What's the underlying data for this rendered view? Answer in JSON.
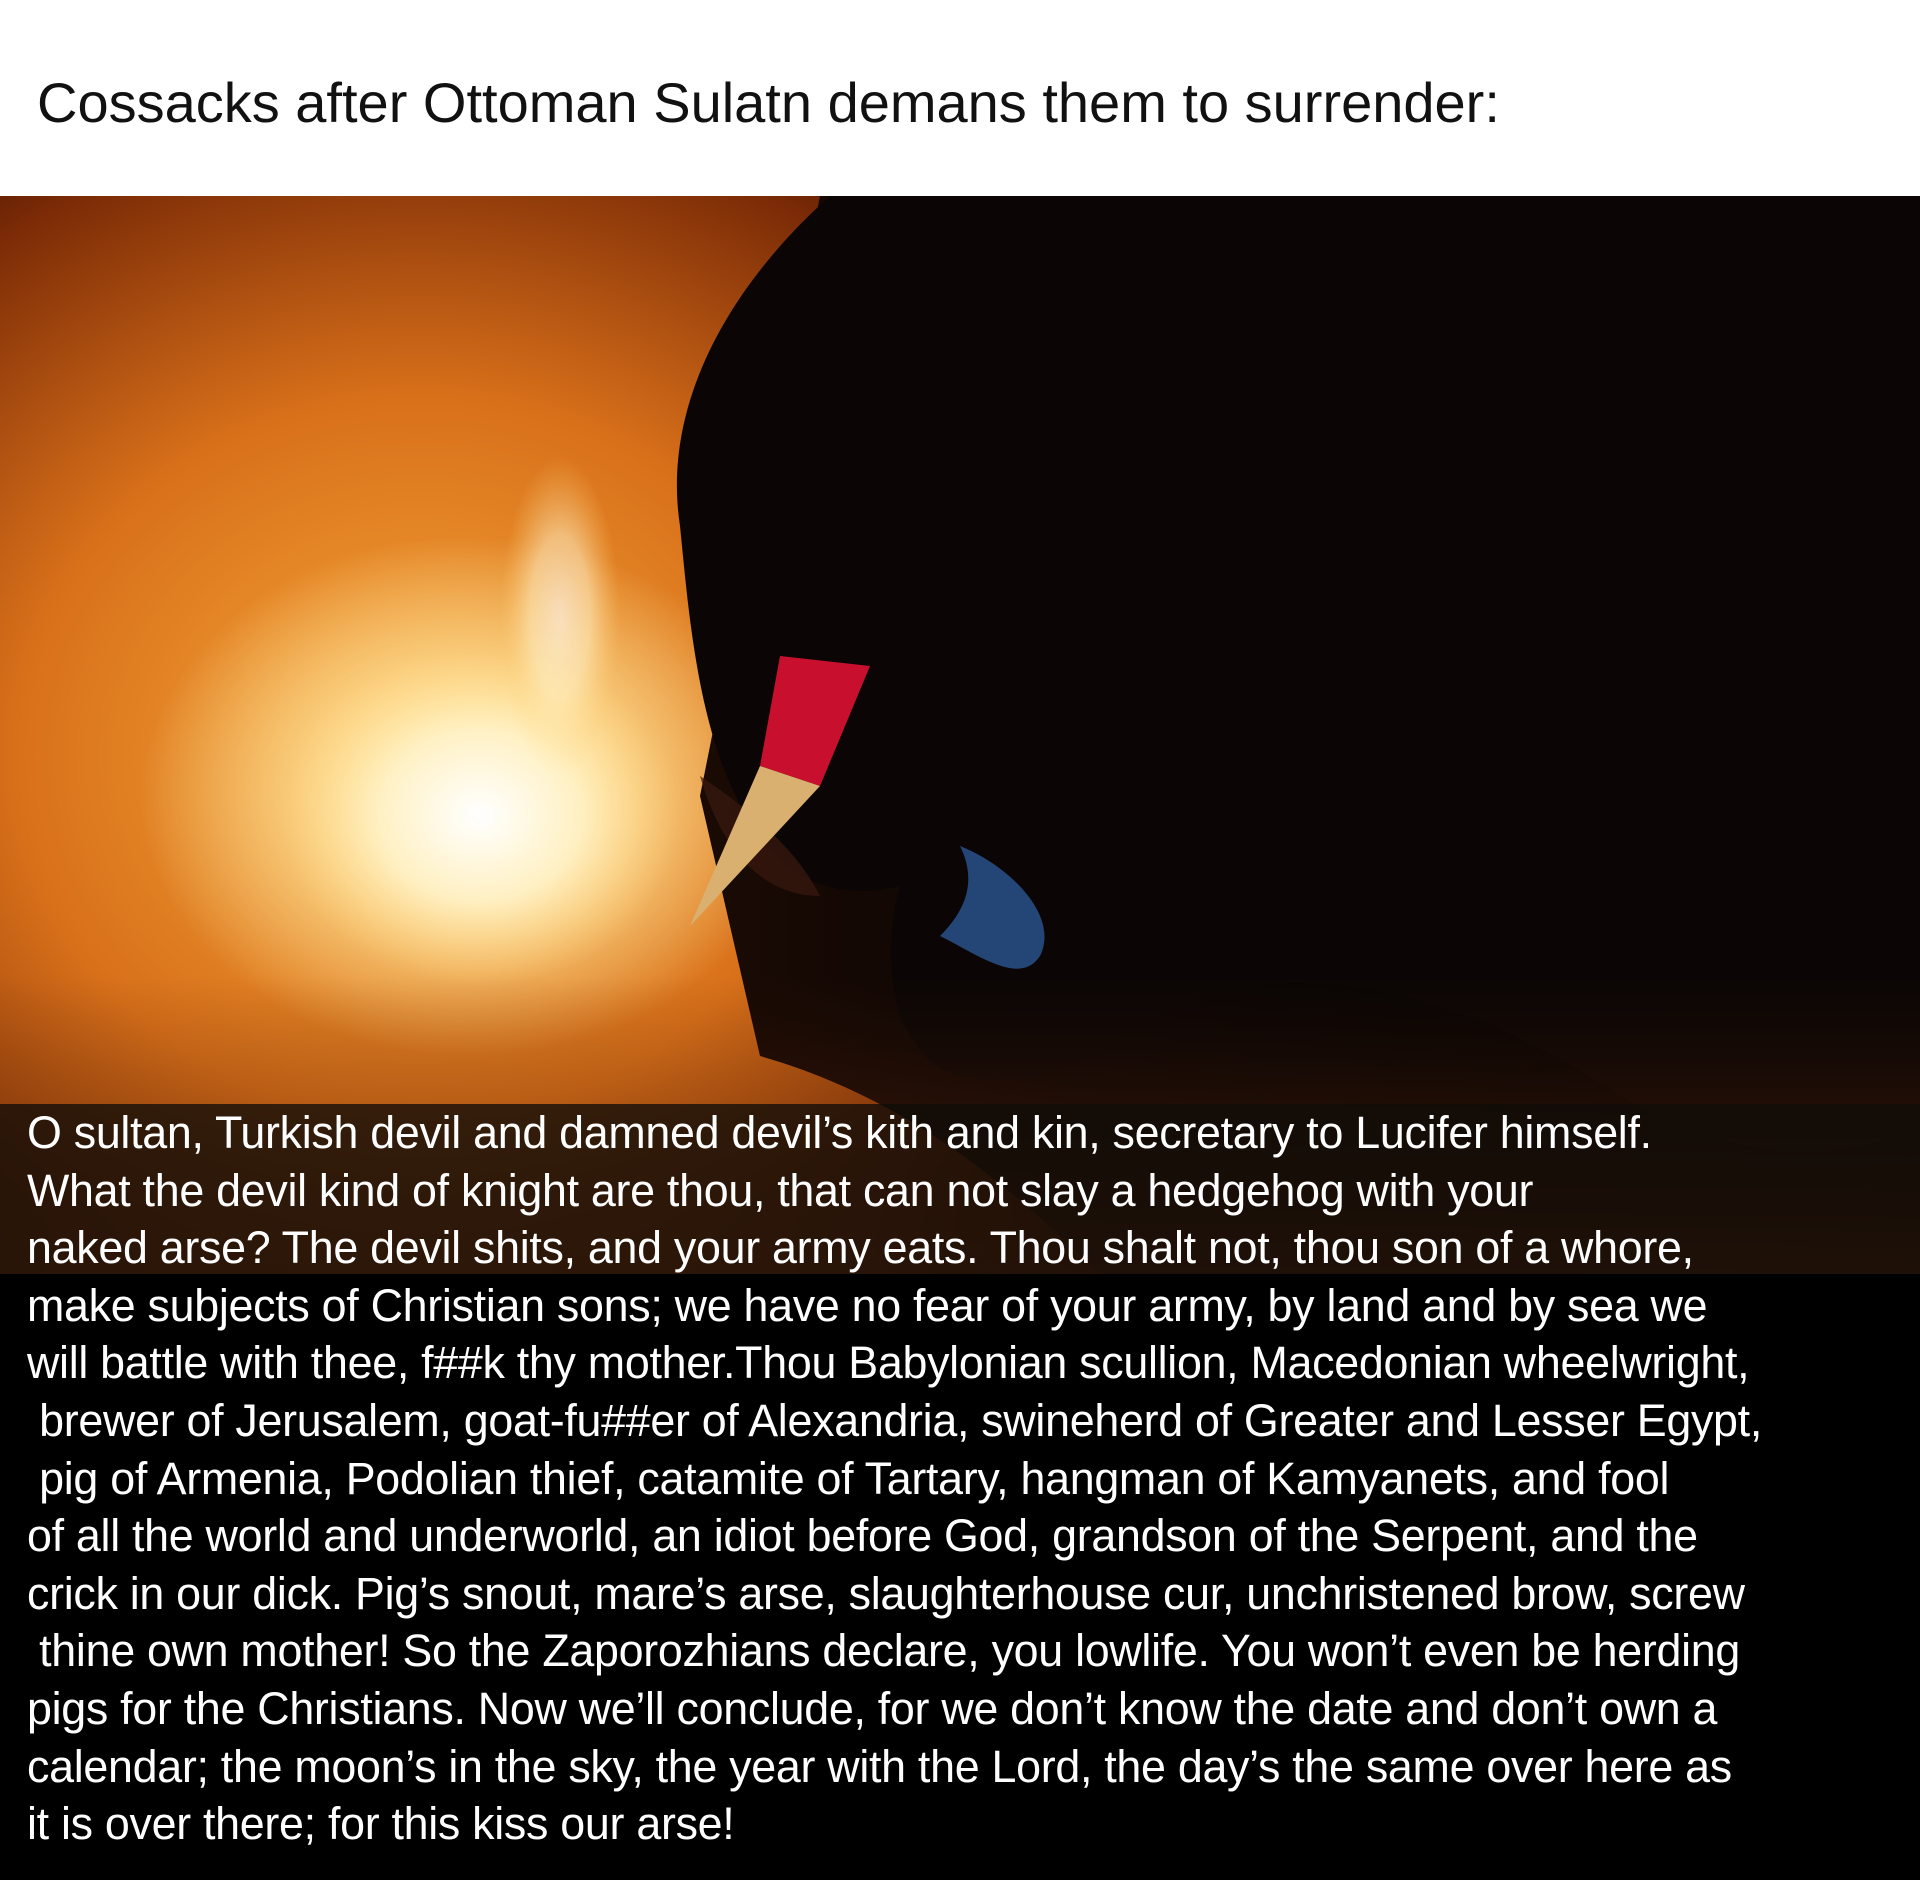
{
  "caption": {
    "title": "Cossacks after Ottoman Sulatn demans them to surrender:"
  },
  "photo": {
    "subject": "hand-holding-quill-with-flame",
    "colors": {
      "glow": "#f7a83a",
      "flame": "#fffbe8",
      "shadow": "#0a0504",
      "quill_red": "#c8102e",
      "blue_flame": "#3a7bd5"
    }
  },
  "letter": {
    "lines": [
      "O sultan, Turkish devil and damned devil’s kith and kin, secretary to Lucifer himself.",
      "What the devil kind of knight are thou, that can not slay a hedgehog with your",
      "naked arse? The devil shits, and your army eats. Thou shalt not, thou son of a whore,",
      "make subjects of Christian sons; we have no fear of your army, by land and by sea we",
      "will battle with thee, f##k thy mother.Thou Babylonian scullion, Macedonian wheelwright,",
      " brewer of Jerusalem, goat-fu##er of Alexandria, swineherd of Greater and Lesser Egypt,",
      " pig of Armenia, Podolian thief, catamite of Tartary, hangman of Kamyanets, and fool",
      "of all the world and underworld, an idiot before God, grandson of the Serpent, and the",
      "crick in our dick. Pig’s snout, mare’s arse, slaughterhouse cur, unchristened brow, screw",
      " thine own mother! So the Zaporozhians declare, you lowlife. You won’t even be herding",
      "pigs for the Christians. Now we’ll conclude, for we don’t know the date and don’t own a",
      "calendar; the moon’s in the sky, the year with the Lord, the day’s the same over here as",
      "it is over there; for this kiss our arse!"
    ]
  }
}
